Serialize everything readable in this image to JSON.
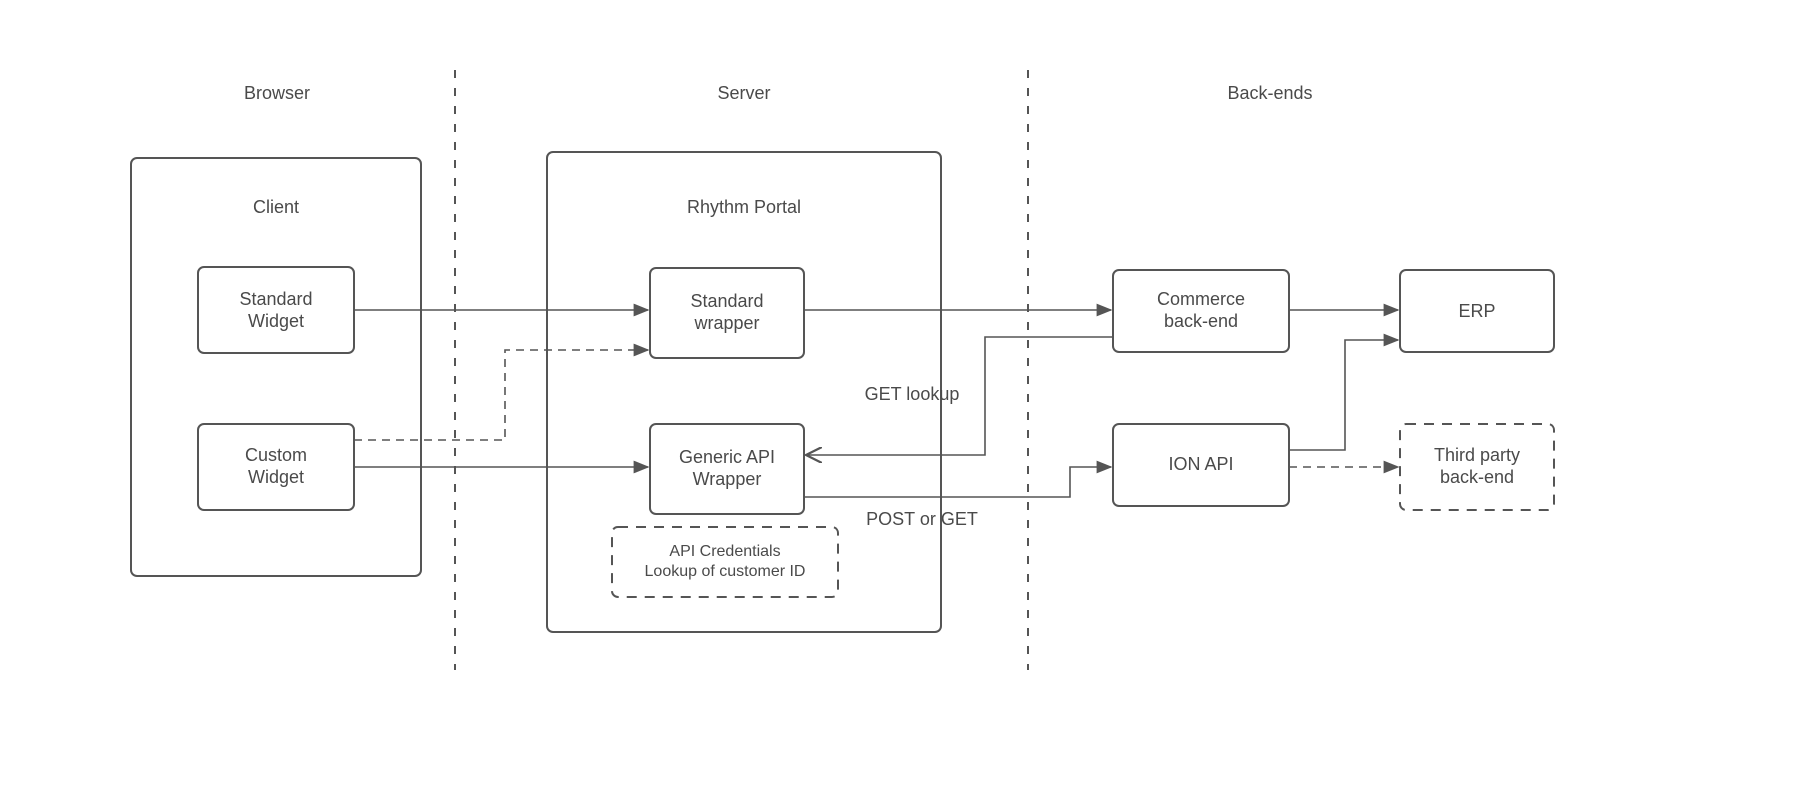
{
  "sections": {
    "browser": "Browser",
    "server": "Server",
    "backends": "Back-ends"
  },
  "client": {
    "title": "Client",
    "standard_widget_l1": "Standard",
    "standard_widget_l2": "Widget",
    "custom_widget_l1": "Custom",
    "custom_widget_l2": "Widget"
  },
  "portal": {
    "title": "Rhythm Portal",
    "standard_wrapper_l1": "Standard",
    "standard_wrapper_l2": "wrapper",
    "generic_api_l1": "Generic API",
    "generic_api_l2": "Wrapper",
    "credentials_l1": "API Credentials",
    "credentials_l2": "Lookup of customer ID"
  },
  "backends": {
    "commerce_l1": "Commerce",
    "commerce_l2": "back-end",
    "ion_api": "ION API",
    "erp": "ERP",
    "third_party_l1": "Third party",
    "third_party_l2": "back-end"
  },
  "arrows": {
    "get_lookup": "GET lookup",
    "post_or_get": "POST or GET"
  }
}
